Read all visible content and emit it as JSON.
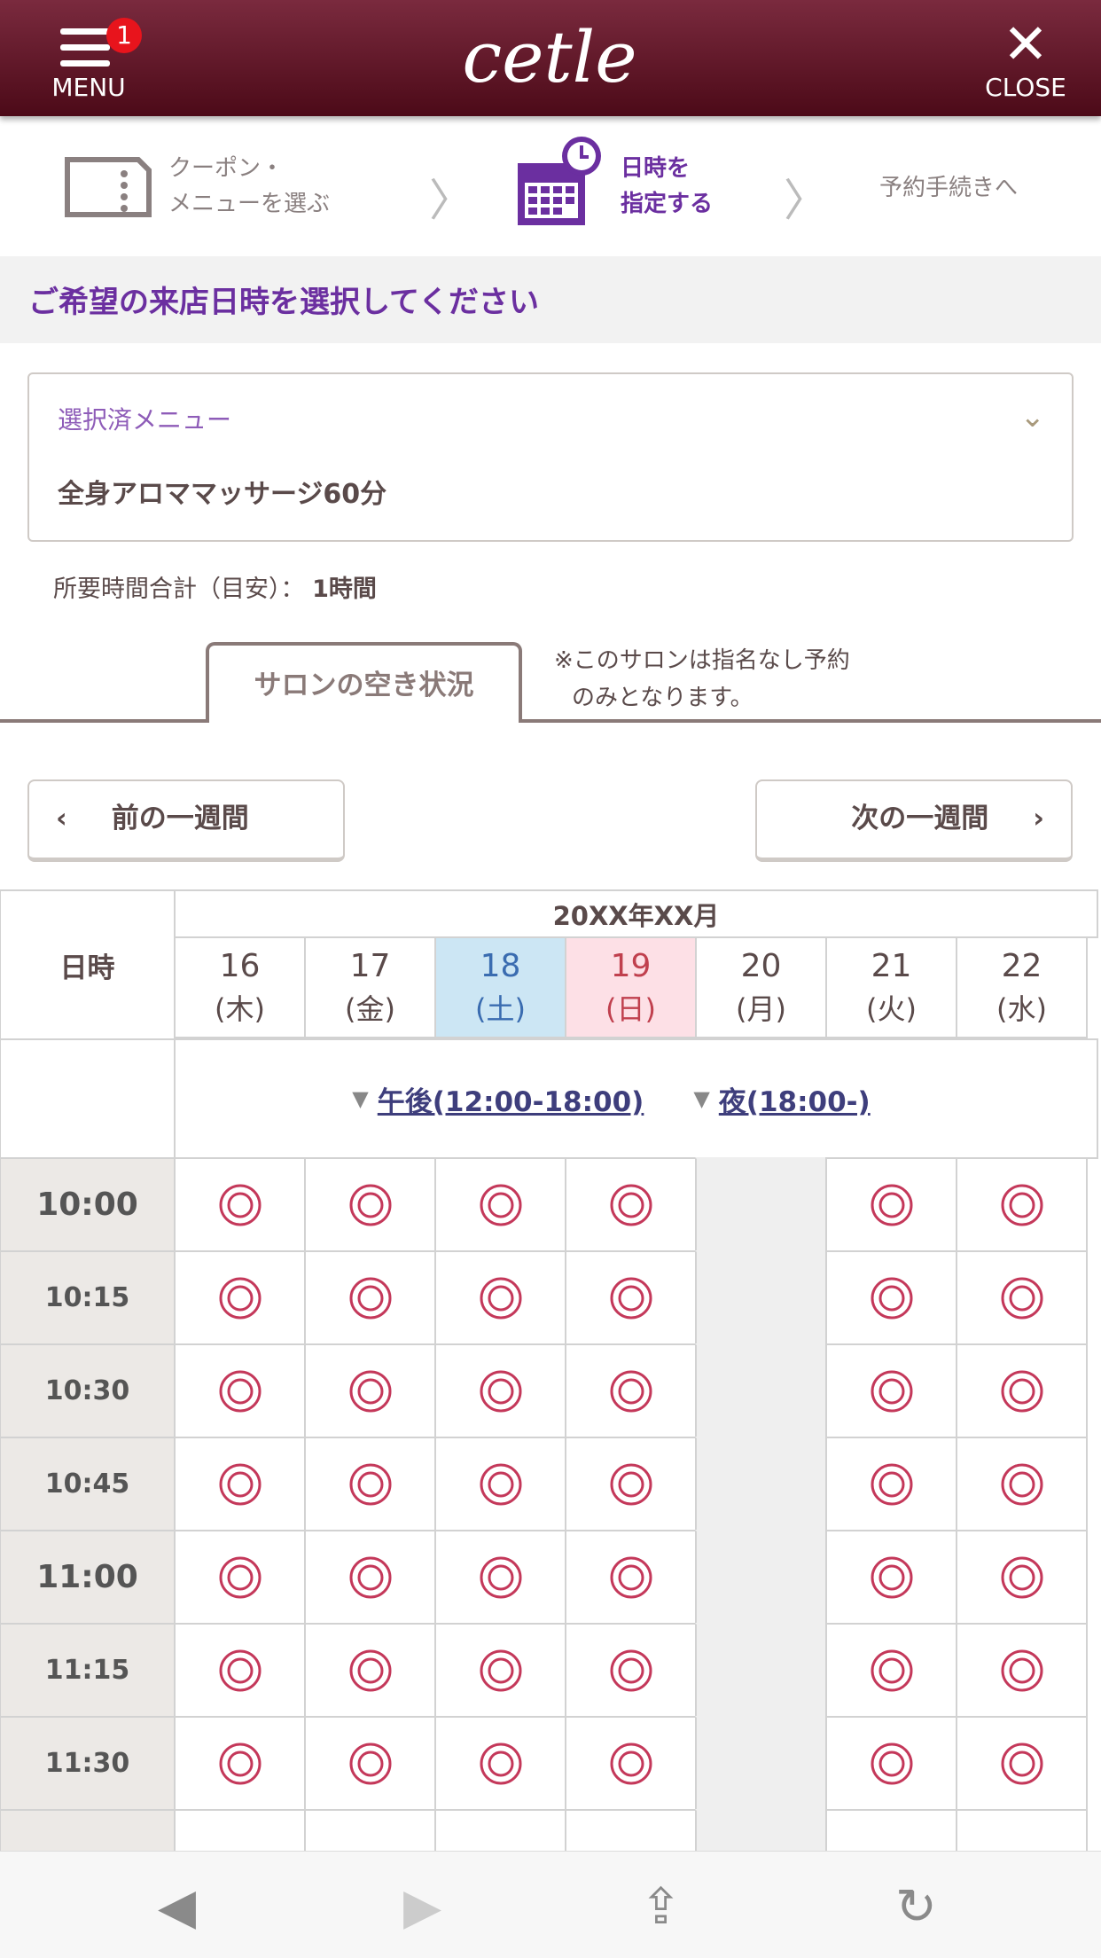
{
  "header": {
    "menu_label": "MENU",
    "menu_badge": "1",
    "logo_text": "cetle",
    "close_label": "CLOSE"
  },
  "steps": [
    {
      "label_1": "クーポン・",
      "label_2": "メニューを選ぶ",
      "icon": "coupon-icon",
      "active": false
    },
    {
      "label_1": "日時を",
      "label_2": "指定する",
      "icon": "calendar-clock-icon",
      "active": true
    },
    {
      "label_1": "予約手続きへ",
      "active": false
    }
  ],
  "page_title": "ご希望の来店日時を選択してください",
  "selected_menu": {
    "label": "選択済メニュー",
    "value": "全身アロママッサージ60分"
  },
  "duration": {
    "label": "所要時間合計（目安）：",
    "value": "1時間"
  },
  "tab": {
    "label": "サロンの空き状況"
  },
  "note": {
    "line1": "※このサロンは指名なし予約",
    "line2": "のみとなります。"
  },
  "nav": {
    "prev": "前の一週間",
    "next": "次の一週間"
  },
  "table": {
    "corner": "日時",
    "month": "20XX年XX月",
    "days": [
      {
        "date": "16",
        "dow": "(木)",
        "type": "weekday"
      },
      {
        "date": "17",
        "dow": "(金)",
        "type": "weekday"
      },
      {
        "date": "18",
        "dow": "(土)",
        "type": "sat"
      },
      {
        "date": "19",
        "dow": "(日)",
        "type": "sun"
      },
      {
        "date": "20",
        "dow": "(月)",
        "type": "weekday"
      },
      {
        "date": "21",
        "dow": "(火)",
        "type": "weekday"
      },
      {
        "date": "22",
        "dow": "(水)",
        "type": "weekday"
      }
    ],
    "links": [
      "午後(12:00-18:00)",
      "夜(18:00-)"
    ],
    "slots": [
      {
        "time": "10:00",
        "hour": true,
        "status": [
          "◎",
          "◎",
          "◎",
          "◎",
          "closed",
          "◎",
          "◎"
        ]
      },
      {
        "time": "10:15",
        "hour": false,
        "status": [
          "◎",
          "◎",
          "◎",
          "◎",
          "closed",
          "◎",
          "◎"
        ]
      },
      {
        "time": "10:30",
        "hour": false,
        "status": [
          "◎",
          "◎",
          "◎",
          "◎",
          "closed",
          "◎",
          "◎"
        ]
      },
      {
        "time": "10:45",
        "hour": false,
        "status": [
          "◎",
          "◎",
          "◎",
          "◎",
          "closed",
          "◎",
          "◎"
        ]
      },
      {
        "time": "11:00",
        "hour": true,
        "status": [
          "◎",
          "◎",
          "◎",
          "◎",
          "closed",
          "◎",
          "◎"
        ]
      },
      {
        "time": "11:15",
        "hour": false,
        "status": [
          "◎",
          "◎",
          "◎",
          "◎",
          "closed",
          "◎",
          "◎"
        ]
      },
      {
        "time": "11:30",
        "hour": false,
        "status": [
          "◎",
          "◎",
          "◎",
          "◎",
          "closed",
          "◎",
          "◎"
        ]
      },
      {
        "time": "",
        "hour": false,
        "status": [
          "",
          "",
          "",
          "",
          "closed",
          "",
          ""
        ]
      }
    ]
  },
  "colors": {
    "header": "#6a1a2c",
    "accent_purple": "#6b2fa0",
    "available": "#c4385a",
    "saturday": "#cce6f4",
    "sunday": "#fde0e6"
  },
  "browser_bar": {
    "icons": [
      "back-icon",
      "forward-icon",
      "share-icon",
      "reload-icon"
    ]
  }
}
